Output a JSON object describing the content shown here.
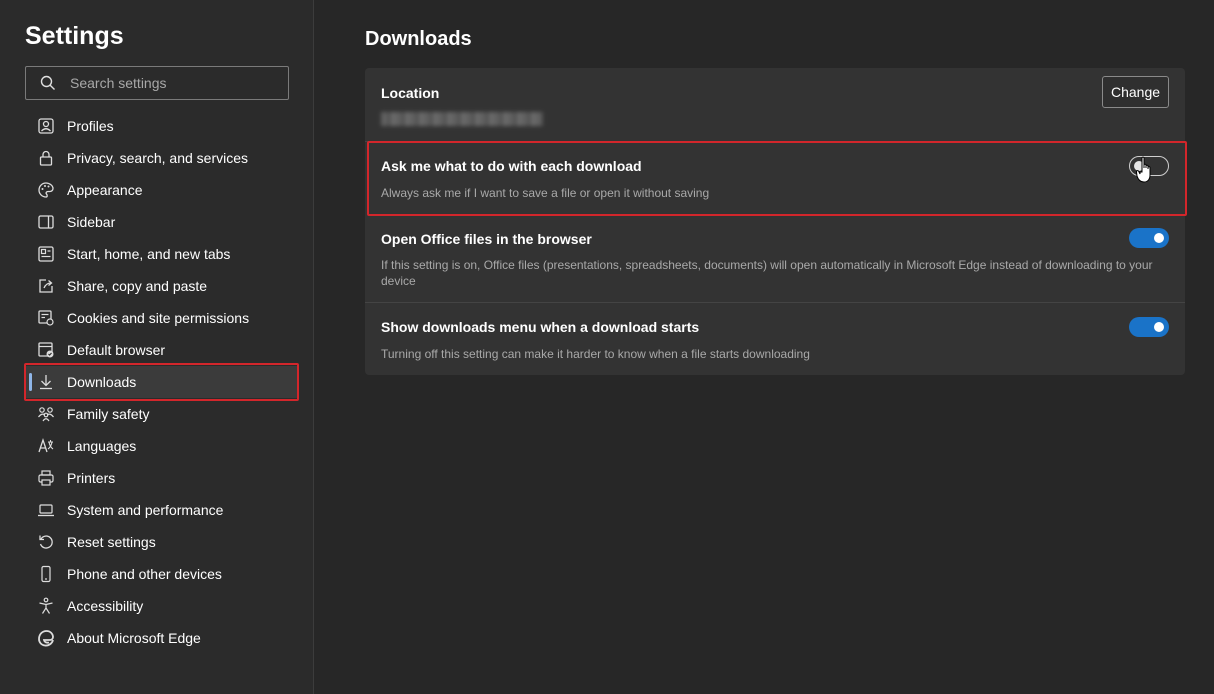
{
  "sidebar": {
    "title": "Settings",
    "search_placeholder": "Search settings",
    "items": [
      {
        "label": "Profiles",
        "icon": "profile-icon"
      },
      {
        "label": "Privacy, search, and services",
        "icon": "lock-icon"
      },
      {
        "label": "Appearance",
        "icon": "palette-icon"
      },
      {
        "label": "Sidebar",
        "icon": "sidebar-icon"
      },
      {
        "label": "Start, home, and new tabs",
        "icon": "home-tabs-icon"
      },
      {
        "label": "Share, copy and paste",
        "icon": "share-icon"
      },
      {
        "label": "Cookies and site permissions",
        "icon": "cookies-icon"
      },
      {
        "label": "Default browser",
        "icon": "default-browser-icon"
      },
      {
        "label": "Downloads",
        "icon": "download-icon"
      },
      {
        "label": "Family safety",
        "icon": "family-icon"
      },
      {
        "label": "Languages",
        "icon": "languages-icon"
      },
      {
        "label": "Printers",
        "icon": "printer-icon"
      },
      {
        "label": "System and performance",
        "icon": "laptop-icon"
      },
      {
        "label": "Reset settings",
        "icon": "reset-icon"
      },
      {
        "label": "Phone and other devices",
        "icon": "phone-icon"
      },
      {
        "label": "Accessibility",
        "icon": "accessibility-icon"
      },
      {
        "label": "About Microsoft Edge",
        "icon": "edge-icon"
      }
    ],
    "active_index": 8
  },
  "main": {
    "title": "Downloads",
    "location": {
      "label": "Location",
      "button": "Change"
    },
    "settings": [
      {
        "title": "Ask me what to do with each download",
        "desc": "Always ask me if I want to save a file or open it without saving",
        "enabled": false
      },
      {
        "title": "Open Office files in the browser",
        "desc": "If this setting is on, Office files (presentations, spreadsheets, documents) will open automatically in Microsoft Edge instead of downloading to your device",
        "enabled": true
      },
      {
        "title": "Show downloads menu when a download starts",
        "desc": "Turning off this setting can make it harder to know when a file starts downloading",
        "enabled": true
      }
    ]
  },
  "colors": {
    "accent": "#1a73c8",
    "highlight": "#d3262b",
    "background": "#272727"
  }
}
